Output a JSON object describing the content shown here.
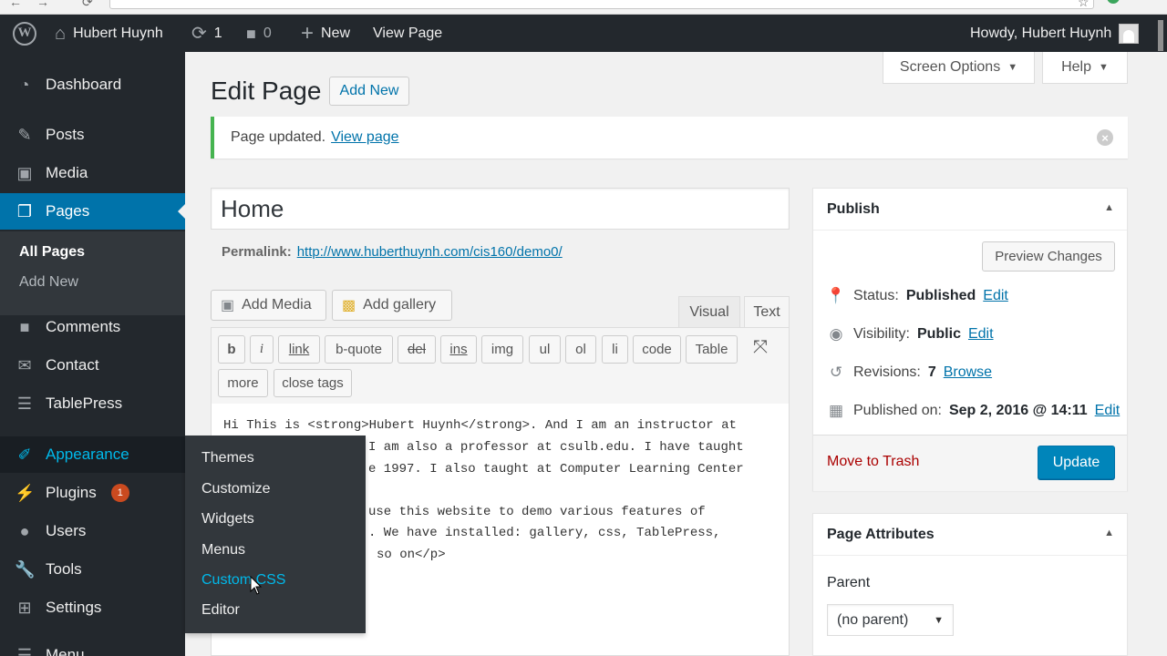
{
  "adminbar": {
    "site_name": "Hubert Huynh",
    "updates_count": "1",
    "comments_count": "0",
    "new_label": "New",
    "view_page_label": "View Page",
    "howdy": "Howdy, Hubert Huynh"
  },
  "sidebar": {
    "items": [
      {
        "label": "Dashboard",
        "icon": "dashboard-icon"
      },
      {
        "label": "Posts",
        "icon": "pin-icon"
      },
      {
        "label": "Media",
        "icon": "media-icon"
      },
      {
        "label": "Pages",
        "icon": "pages-icon"
      },
      {
        "label": "Comments",
        "icon": "comments-icon"
      },
      {
        "label": "Contact",
        "icon": "mail-icon"
      },
      {
        "label": "TablePress",
        "icon": "table-icon"
      },
      {
        "label": "Appearance",
        "icon": "brush-icon"
      },
      {
        "label": "Plugins",
        "icon": "plugin-icon",
        "badge": "1"
      },
      {
        "label": "Users",
        "icon": "users-icon"
      },
      {
        "label": "Tools",
        "icon": "wrench-icon"
      },
      {
        "label": "Settings",
        "icon": "settings-icon"
      },
      {
        "label": "Menu",
        "icon": "menu-icon"
      }
    ],
    "pages_submenu": [
      "All Pages",
      "Add New"
    ]
  },
  "appearance_flyout": [
    "Themes",
    "Customize",
    "Widgets",
    "Menus",
    "Custom CSS",
    "Editor"
  ],
  "screen_options": {
    "screen_options_label": "Screen Options",
    "help_label": "Help"
  },
  "header": {
    "title": "Edit Page",
    "add_new_label": "Add New"
  },
  "notice": {
    "text": "Page updated.",
    "link": "View page"
  },
  "editor": {
    "title_value": "Home",
    "permalink_label": "Permalink:",
    "permalink_url": "http://www.huberthuynh.com/cis160/demo0/",
    "add_media_label": "Add Media",
    "add_gallery_label": "Add gallery",
    "tab_visual": "Visual",
    "tab_text": "Text",
    "quicktags": [
      "b",
      "i",
      "link",
      "b-quote",
      "del",
      "ins",
      "img",
      "ul",
      "ol",
      "li",
      "code",
      "Table",
      "more",
      "close tags"
    ],
    "content_lines": [
      "Hi This is <strong>Hubert Huynh</strong>. And I am an instructor at",
      "I am also a professor at csulb.edu. I have taught",
      "e 1997. I also taught at Computer Learning Center",
      "use this website to demo various features of",
      ". We have installed: gallery, css, TablePress,",
      "so on</p>"
    ]
  },
  "publish": {
    "title": "Publish",
    "preview_label": "Preview Changes",
    "status_label": "Status:",
    "status_value": "Published",
    "visibility_label": "Visibility:",
    "visibility_value": "Public",
    "revisions_label": "Revisions:",
    "revisions_value": "7",
    "browse_label": "Browse",
    "published_on_label": "Published on:",
    "published_on_value": "Sep 2, 2016 @ 14:11",
    "edit_label": "Edit",
    "trash_label": "Move to Trash",
    "update_label": "Update"
  },
  "page_attributes": {
    "title": "Page Attributes",
    "parent_label": "Parent",
    "parent_value": "(no parent)"
  },
  "colors": {
    "admin_bar": "#23282d",
    "accent": "#0073aa",
    "update_button": "#0085ba",
    "link_hover": "#00b9eb",
    "notice_success": "#46b450",
    "trash": "#aa0000",
    "badge": "#ca4a1f"
  }
}
